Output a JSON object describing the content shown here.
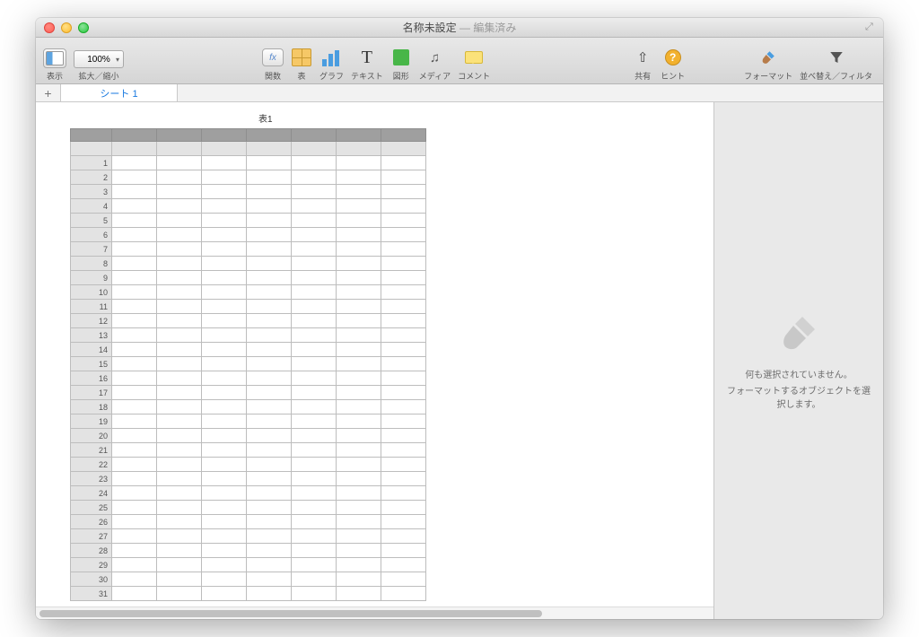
{
  "window": {
    "title": "名称未設定",
    "subtitle": "— 編集済み"
  },
  "toolbar": {
    "view_label": "表示",
    "zoom_value": "100%",
    "zoom_label": "拡大／縮小",
    "fx_label": "関数",
    "table_label": "表",
    "chart_label": "グラフ",
    "text_label": "テキスト",
    "shape_label": "図形",
    "media_label": "メディア",
    "comment_label": "コメント",
    "share_label": "共有",
    "hint_label": "ヒント",
    "format_label": "フォーマット",
    "sort_label": "並べ替え／フィルタ"
  },
  "tabs": {
    "sheet1": "シート 1"
  },
  "table": {
    "name": "表1",
    "rows": [
      "1",
      "2",
      "3",
      "4",
      "5",
      "6",
      "7",
      "8",
      "9",
      "10",
      "11",
      "12",
      "13",
      "14",
      "15",
      "16",
      "17",
      "18",
      "19",
      "20",
      "21",
      "22",
      "23",
      "24",
      "25",
      "26",
      "27",
      "28",
      "29",
      "30",
      "31"
    ],
    "cols": 7
  },
  "inspector": {
    "line1": "何も選択されていません。",
    "line2": "フォーマットするオブジェクトを選択します。"
  }
}
